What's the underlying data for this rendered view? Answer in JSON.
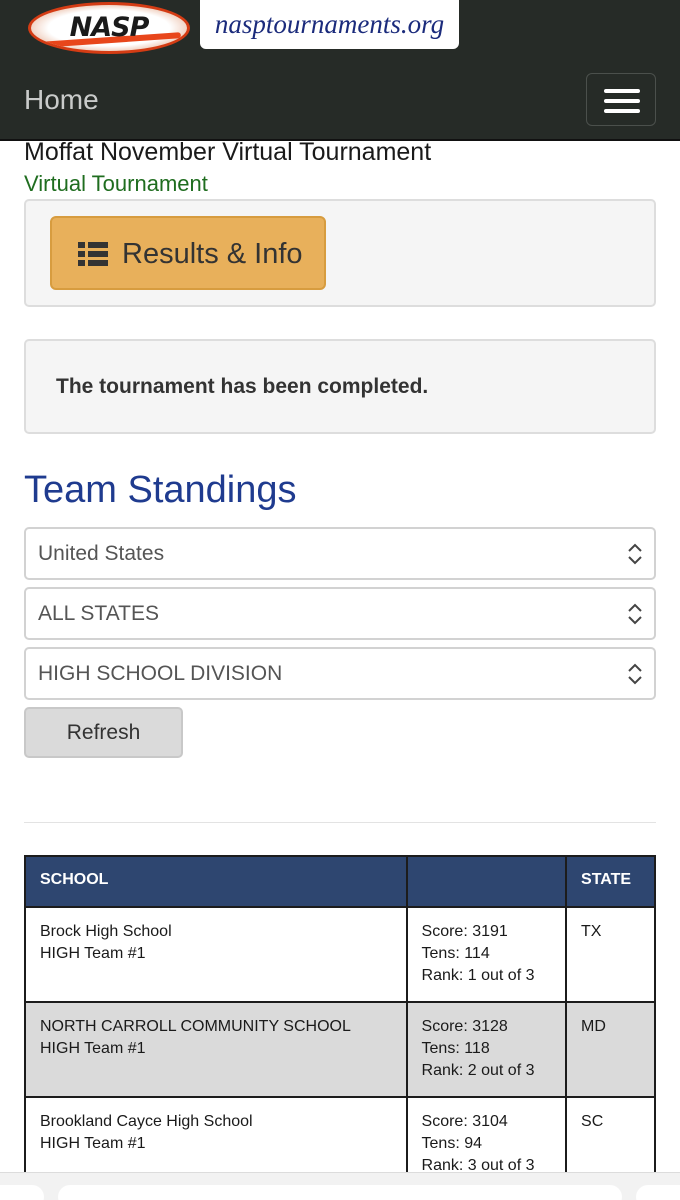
{
  "header": {
    "logo_text": "NASP",
    "site_name": "nasptournaments.org",
    "home_label": "Home",
    "menu_icon": "hamburger-menu-icon"
  },
  "tournament": {
    "title": "Moffat November Virtual Tournament",
    "subtitle": "Virtual Tournament"
  },
  "results_button": {
    "label": "Results & Info",
    "icon": "list-icon",
    "color": "#e8b05b"
  },
  "status": {
    "message": "The tournament has been completed."
  },
  "standings": {
    "heading": "Team Standings",
    "filters": {
      "country": "United States",
      "state": "ALL STATES",
      "division": "HIGH SCHOOL DIVISION"
    },
    "refresh_label": "Refresh",
    "columns": [
      "SCHOOL",
      "",
      "STATE"
    ],
    "rows": [
      {
        "school": "Brock High School",
        "team": "HIGH Team #1",
        "score": "Score: 3191",
        "tens": "Tens: 114",
        "rank": "Rank: 1 out of 3",
        "state": "TX"
      },
      {
        "school": "NORTH CARROLL COMMUNITY SCHOOL",
        "team": "HIGH Team #1",
        "score": "Score: 3128",
        "tens": "Tens: 118",
        "rank": "Rank: 2 out of 3",
        "state": "MD"
      },
      {
        "school": "Brookland Cayce High School",
        "team": "HIGH Team #1",
        "score": "Score: 3104",
        "tens": "Tens: 94",
        "rank": "Rank: 3 out of 3",
        "state": "SC"
      }
    ]
  },
  "colors": {
    "header_bg": "#262b27",
    "heading_blue": "#1f3b8f",
    "subtitle_green": "#1f6d1f",
    "table_header": "#2e4670"
  }
}
